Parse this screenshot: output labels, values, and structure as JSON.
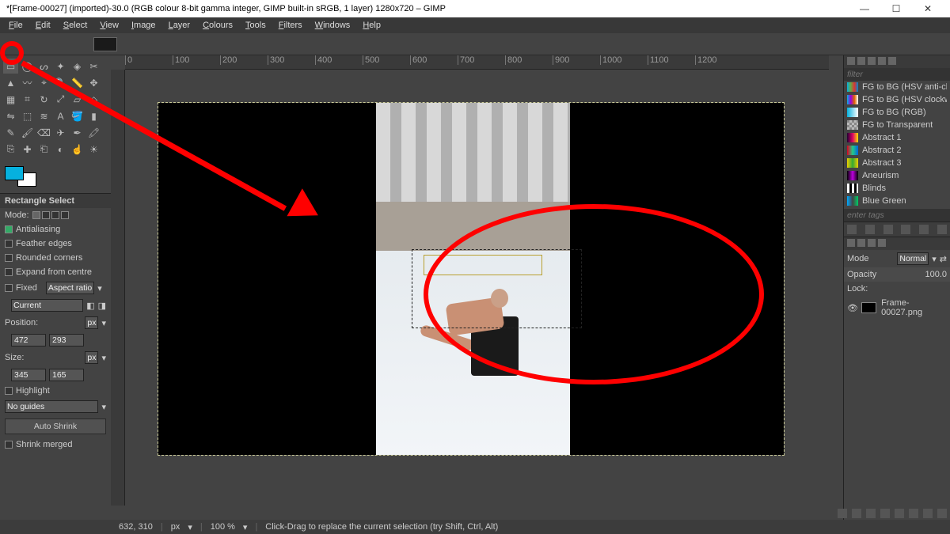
{
  "window": {
    "title": "*[Frame-00027] (imported)-30.0 (RGB colour 8-bit gamma integer, GIMP built-in sRGB, 1 layer) 1280x720 – GIMP"
  },
  "menus": [
    "File",
    "Edit",
    "Select",
    "View",
    "Image",
    "Layer",
    "Colours",
    "Tools",
    "Filters",
    "Windows",
    "Help"
  ],
  "tool_options": {
    "title": "Rectangle Select",
    "mode_label": "Mode:",
    "antialiasing": "Antialiasing",
    "feather": "Feather edges",
    "rounded": "Rounded corners",
    "expand": "Expand from centre",
    "fixed": "Fixed",
    "fixed_type": "Aspect ratio",
    "current": "Current",
    "position_label": "Position:",
    "pos_unit": "px",
    "pos_x": "472",
    "pos_y": "293",
    "size_label": "Size:",
    "size_unit": "px",
    "size_w": "345",
    "size_h": "165",
    "highlight": "Highlight",
    "guides": "No guides",
    "auto_shrink": "Auto Shrink",
    "shrink_merged": "Shrink merged"
  },
  "gradients": {
    "filter_placeholder": "filter",
    "items": [
      {
        "label": "FG to BG (HSV anti-clockwise)",
        "sw": "linear-gradient(90deg,#06b1de,#6a4,#d33,#08c)"
      },
      {
        "label": "FG to BG (HSV clockwise)",
        "sw": "linear-gradient(90deg,#06b1de,#90d,#d60,#fff)"
      },
      {
        "label": "FG to BG (RGB)",
        "sw": "linear-gradient(90deg,#06b1de,#fff)"
      },
      {
        "label": "FG to Transparent",
        "sw": "repeating-conic-gradient(#888 0 25%,#bbb 0 50%) 0/6px 6px"
      },
      {
        "label": "Abstract 1",
        "sw": "linear-gradient(90deg,#203,#d06,#fd0)"
      },
      {
        "label": "Abstract 2",
        "sw": "linear-gradient(90deg,#d02,#2c8,#06d)"
      },
      {
        "label": "Abstract 3",
        "sw": "linear-gradient(90deg,#ec0,#3a3,#ec0)"
      },
      {
        "label": "Aneurism",
        "sw": "linear-gradient(90deg,#000,#b0d,#000)"
      },
      {
        "label": "Blinds",
        "sw": "repeating-linear-gradient(90deg,#fff 0 3px,#000 3px 6px)"
      },
      {
        "label": "Blue Green",
        "sw": "linear-gradient(90deg,#0af,#0000,#0c6)"
      }
    ],
    "tags_placeholder": "enter tags"
  },
  "layers": {
    "mode_label": "Mode",
    "mode_value": "Normal",
    "opacity_label": "Opacity",
    "opacity_value": "100.0",
    "lock_label": "Lock:",
    "layer_name": "Frame-00027.png"
  },
  "status": {
    "coords": "632, 310",
    "unit": "px",
    "zoom": "100 %",
    "hint": "Click-Drag to replace the current selection (try Shift, Ctrl, Alt)"
  },
  "ruler_marks": [
    "0",
    "100",
    "200",
    "300",
    "400",
    "500",
    "600",
    "700",
    "800",
    "900",
    "1000",
    "1100",
    "1200"
  ],
  "tool_names": [
    "rect-select",
    "ellipse-select",
    "free-select",
    "fuzzy-select",
    "color-select",
    "scissors",
    "foreground",
    "paths",
    "color-picker",
    "zoom",
    "measure",
    "move",
    "align",
    "crop",
    "rotate",
    "scale",
    "shear",
    "perspective",
    "flip",
    "cage",
    "warp",
    "text",
    "bucket",
    "gradient",
    "pencil",
    "paintbrush",
    "eraser",
    "airbrush",
    "ink",
    "mypaint",
    "clone",
    "heal",
    "persp-clone",
    "blur",
    "smudge",
    "dodge"
  ]
}
